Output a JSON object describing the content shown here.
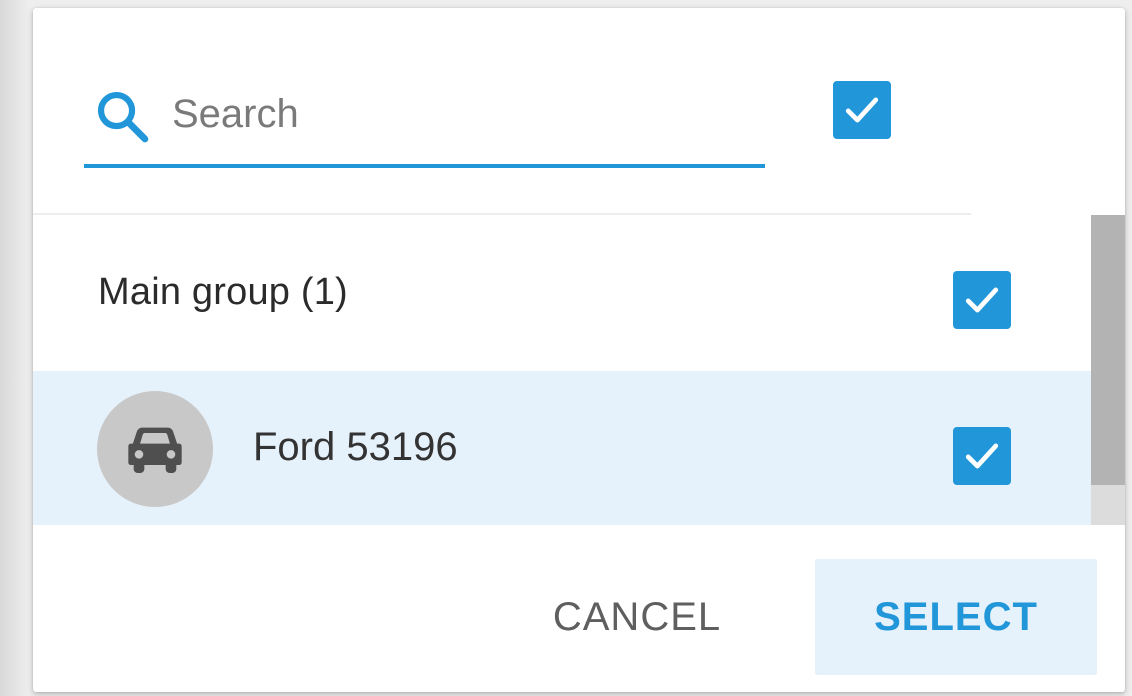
{
  "search": {
    "placeholder": "Search",
    "value": ""
  },
  "select_all": {
    "checked": true
  },
  "groups": [
    {
      "label": "Main group (1)",
      "checked": true,
      "items": [
        {
          "label": "Ford 53196",
          "icon": "car-icon",
          "checked": true,
          "highlighted": true
        }
      ]
    }
  ],
  "footer": {
    "cancel_label": "CANCEL",
    "select_label": "SELECT"
  },
  "colors": {
    "accent": "#2196d8",
    "row_highlight": "#e6f2fb",
    "avatar_bg": "#c8c8c8"
  }
}
